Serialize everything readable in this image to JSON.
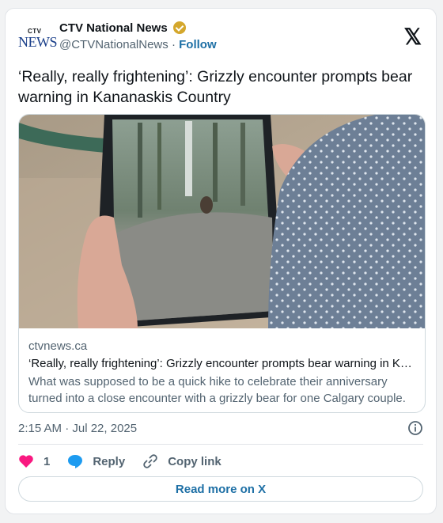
{
  "author": {
    "display_name": "CTV National News",
    "handle": "@CTVNationalNews",
    "separator": "·",
    "follow_label": "Follow",
    "logo_top": "CTV",
    "logo_main": "NEWS",
    "verified_color": "#d4a72c"
  },
  "platform_icon": "x-logo",
  "platform_glyph": "𝕏",
  "tweet": {
    "text": "‘Really, really frightening’: Grizzly encounter prompts bear warning in Kananaskis Country"
  },
  "link_card": {
    "domain": "ctvnews.ca",
    "title": "‘Really, really frightening’: Grizzly encounter prompts bear warning in K…",
    "description": "What was supposed to be a quick hike to celebrate their anniversary turned into a close encounter with a grizzly bear for one Calgary couple."
  },
  "timestamp": "2:15 AM · Jul 22, 2025",
  "actions": {
    "like_count": "1",
    "reply_label": "Reply",
    "copy_link_label": "Copy link"
  },
  "read_more_label": "Read more on X",
  "colors": {
    "accent": "#1d6fa5",
    "like": "#f91880",
    "reply": "#1d9bf0",
    "secondary_text": "#536471"
  }
}
